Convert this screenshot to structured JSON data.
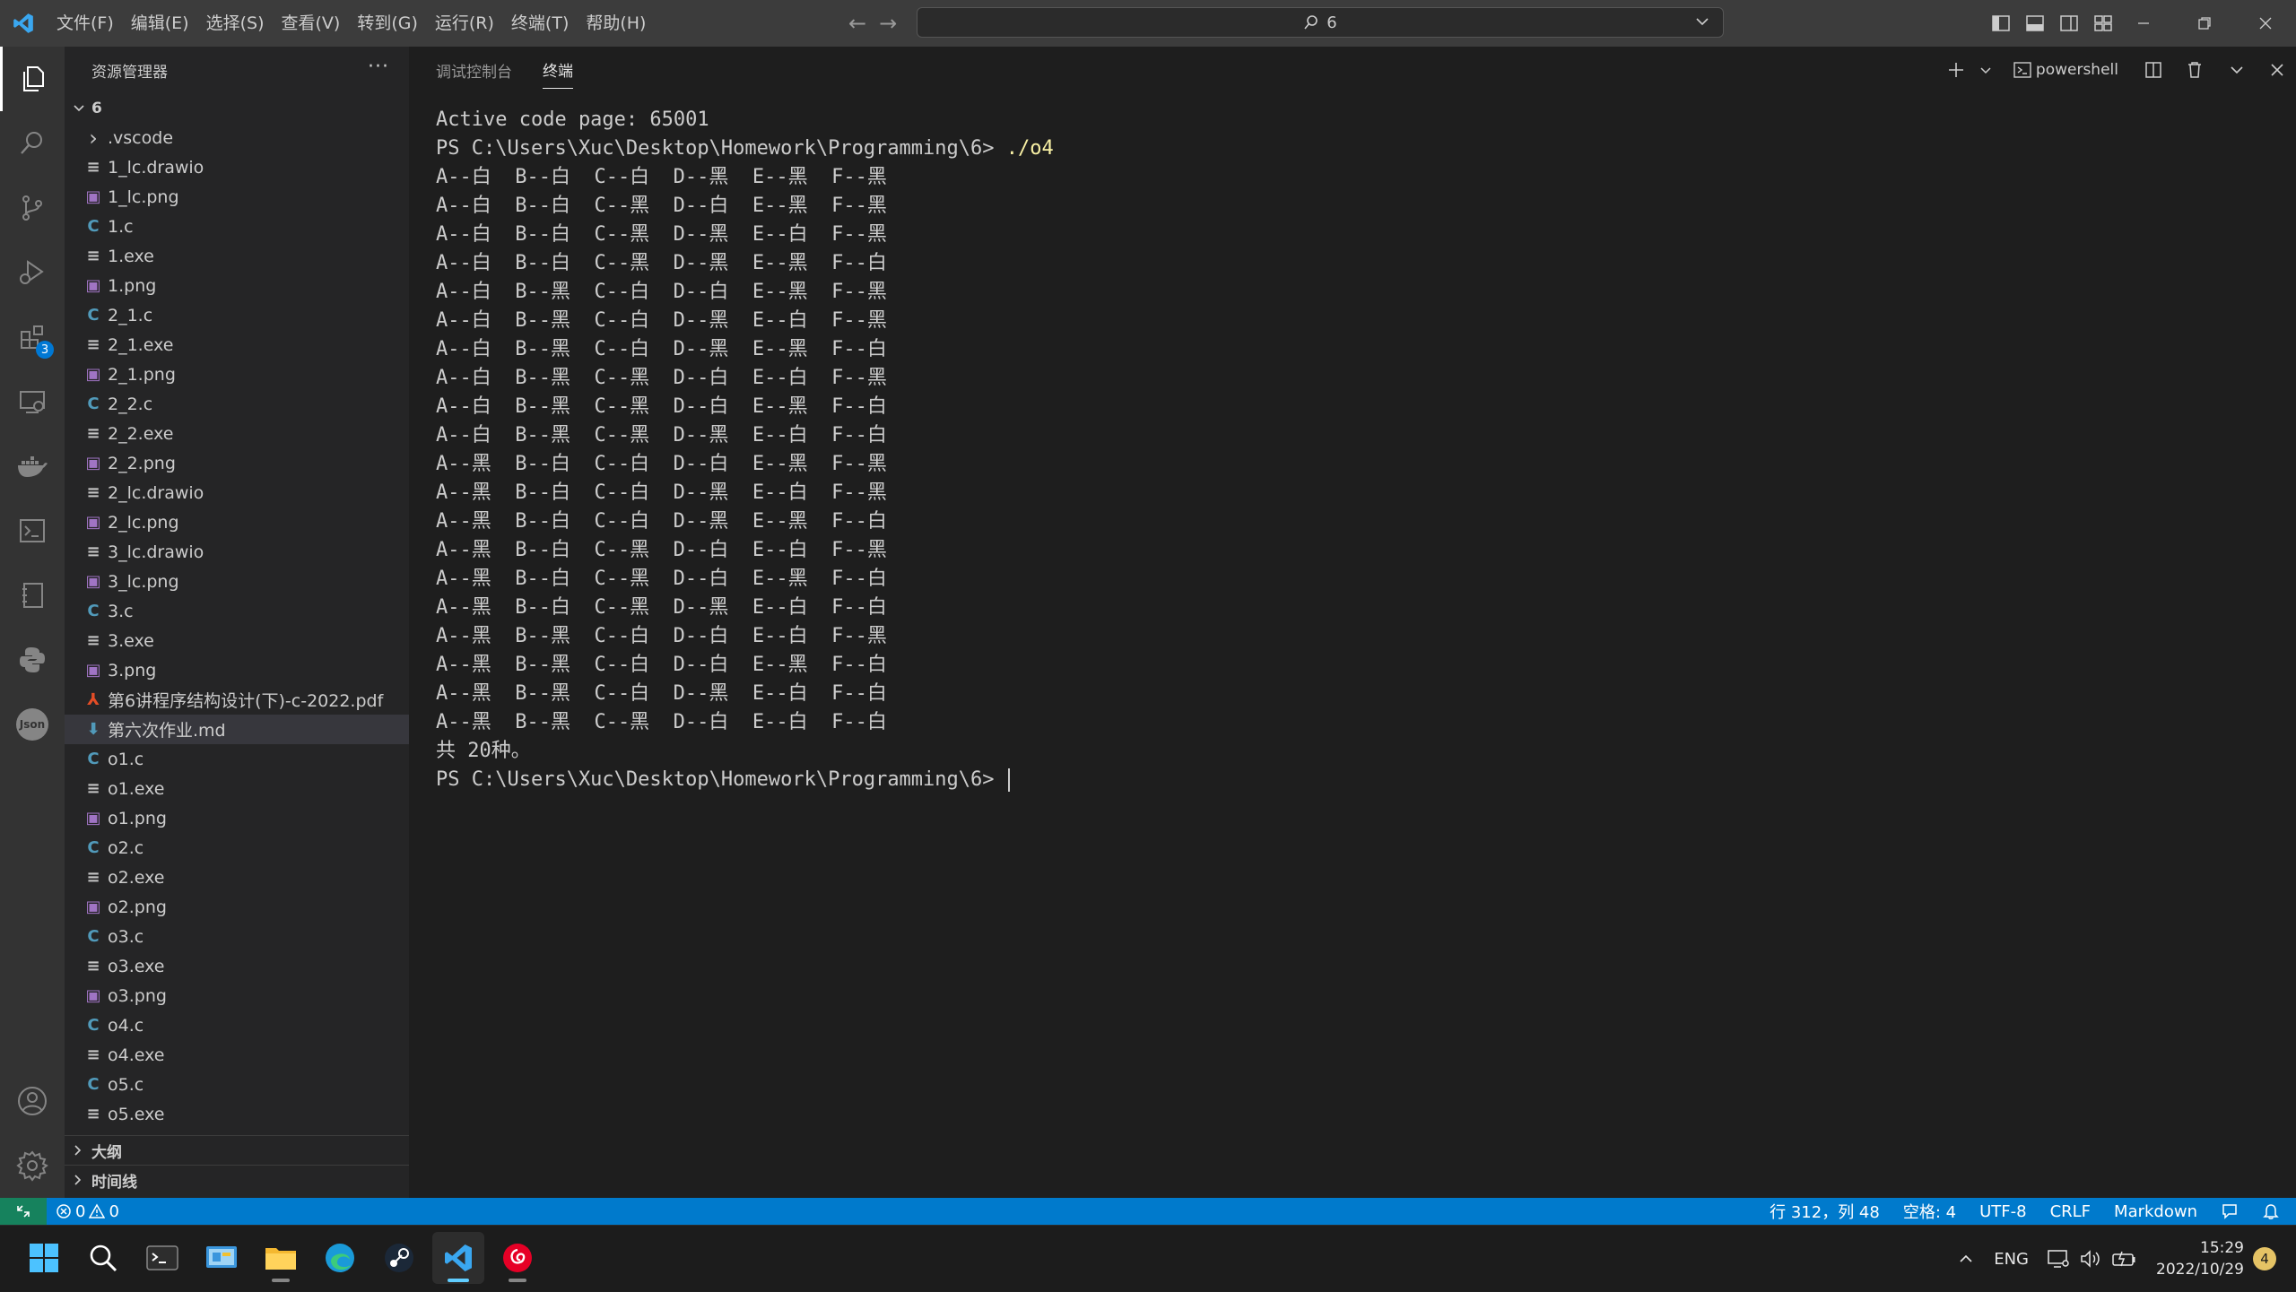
{
  "titlebar": {
    "menu": [
      "文件(F)",
      "编辑(E)",
      "选择(S)",
      "查看(V)",
      "转到(G)",
      "运行(R)",
      "终端(T)",
      "帮助(H)"
    ],
    "search_text": "6"
  },
  "activitybar": {
    "items": [
      "explorer-icon",
      "search-icon",
      "source-control-icon",
      "run-debug-icon",
      "extensions-icon",
      "remote-explorer-icon",
      "docker-icon",
      "terminal-icon",
      "notebook-icon",
      "python-icon",
      "json-icon"
    ],
    "extensions_badge": "3",
    "json_label": "Json"
  },
  "sidebar": {
    "title": "资源管理器",
    "folder": "6",
    "files": [
      {
        "name": ".vscode",
        "type": "folder"
      },
      {
        "name": "1_lc.drawio",
        "type": "text"
      },
      {
        "name": "1_lc.png",
        "type": "image"
      },
      {
        "name": "1.c",
        "type": "c"
      },
      {
        "name": "1.exe",
        "type": "text"
      },
      {
        "name": "1.png",
        "type": "image"
      },
      {
        "name": "2_1.c",
        "type": "c"
      },
      {
        "name": "2_1.exe",
        "type": "text"
      },
      {
        "name": "2_1.png",
        "type": "image"
      },
      {
        "name": "2_2.c",
        "type": "c"
      },
      {
        "name": "2_2.exe",
        "type": "text"
      },
      {
        "name": "2_2.png",
        "type": "image"
      },
      {
        "name": "2_lc.drawio",
        "type": "text"
      },
      {
        "name": "2_lc.png",
        "type": "image"
      },
      {
        "name": "3_lc.drawio",
        "type": "text"
      },
      {
        "name": "3_lc.png",
        "type": "image"
      },
      {
        "name": "3.c",
        "type": "c"
      },
      {
        "name": "3.exe",
        "type": "text"
      },
      {
        "name": "3.png",
        "type": "image"
      },
      {
        "name": "第6讲程序结构设计(下)-c-2022.pdf",
        "type": "pdf"
      },
      {
        "name": "第六次作业.md",
        "type": "md",
        "selected": true
      },
      {
        "name": "o1.c",
        "type": "c"
      },
      {
        "name": "o1.exe",
        "type": "text"
      },
      {
        "name": "o1.png",
        "type": "image"
      },
      {
        "name": "o2.c",
        "type": "c"
      },
      {
        "name": "o2.exe",
        "type": "text"
      },
      {
        "name": "o2.png",
        "type": "image"
      },
      {
        "name": "o3.c",
        "type": "c"
      },
      {
        "name": "o3.exe",
        "type": "text"
      },
      {
        "name": "o3.png",
        "type": "image"
      },
      {
        "name": "o4.c",
        "type": "c"
      },
      {
        "name": "o4.exe",
        "type": "text"
      },
      {
        "name": "o5.c",
        "type": "c"
      },
      {
        "name": "o5.exe",
        "type": "text"
      }
    ],
    "outline_label": "大纲",
    "timeline_label": "时间线"
  },
  "panel": {
    "tabs": [
      {
        "label": "调试控制台",
        "active": false
      },
      {
        "label": "终端",
        "active": true
      }
    ],
    "terminal_name": "powershell",
    "lines": [
      {
        "text": "Active code page: 65001"
      },
      {
        "text": "PS C:\\Users\\Xuc\\Desktop\\Homework\\Programming\\6> ",
        "cmd": "./o4"
      },
      {
        "text": "A--白  B--白  C--白  D--黑  E--黑  F--黑"
      },
      {
        "text": "A--白  B--白  C--黑  D--白  E--黑  F--黑"
      },
      {
        "text": "A--白  B--白  C--黑  D--黑  E--白  F--黑"
      },
      {
        "text": "A--白  B--白  C--黑  D--黑  E--黑  F--白"
      },
      {
        "text": "A--白  B--黑  C--白  D--白  E--黑  F--黑"
      },
      {
        "text": "A--白  B--黑  C--白  D--黑  E--白  F--黑"
      },
      {
        "text": "A--白  B--黑  C--白  D--黑  E--黑  F--白"
      },
      {
        "text": "A--白  B--黑  C--黑  D--白  E--白  F--黑"
      },
      {
        "text": "A--白  B--黑  C--黑  D--白  E--黑  F--白"
      },
      {
        "text": "A--白  B--黑  C--黑  D--黑  E--白  F--白"
      },
      {
        "text": "A--黑  B--白  C--白  D--白  E--黑  F--黑"
      },
      {
        "text": "A--黑  B--白  C--白  D--黑  E--白  F--黑"
      },
      {
        "text": "A--黑  B--白  C--白  D--黑  E--黑  F--白"
      },
      {
        "text": "A--黑  B--白  C--黑  D--白  E--白  F--黑"
      },
      {
        "text": "A--黑  B--白  C--黑  D--白  E--黑  F--白"
      },
      {
        "text": "A--黑  B--白  C--黑  D--黑  E--白  F--白"
      },
      {
        "text": "A--黑  B--黑  C--白  D--白  E--白  F--黑"
      },
      {
        "text": "A--黑  B--黑  C--白  D--白  E--黑  F--白"
      },
      {
        "text": "A--黑  B--黑  C--白  D--黑  E--白  F--白"
      },
      {
        "text": "A--黑  B--黑  C--黑  D--白  E--白  F--白"
      },
      {
        "text": "共 20种。"
      },
      {
        "text": "PS C:\\Users\\Xuc\\Desktop\\Homework\\Programming\\6> ",
        "cursor": true
      }
    ]
  },
  "statusbar": {
    "errors": "0",
    "warnings": "0",
    "position": "行 312，列 48",
    "spaces": "空格: 4",
    "encoding": "UTF-8",
    "eol": "CRLF",
    "language": "Markdown"
  },
  "taskbar": {
    "apps": [
      "windows-start",
      "search",
      "terminal",
      "control-panel",
      "file-explorer",
      "edge",
      "steam",
      "vscode",
      "netease-music"
    ],
    "lang": "ENG",
    "time": "15:29",
    "date": "2022/10/29",
    "notifications": "4"
  },
  "colors": {
    "accent": "#007acc",
    "remote": "#16825d",
    "terminal_command": "#f9f1a5"
  }
}
